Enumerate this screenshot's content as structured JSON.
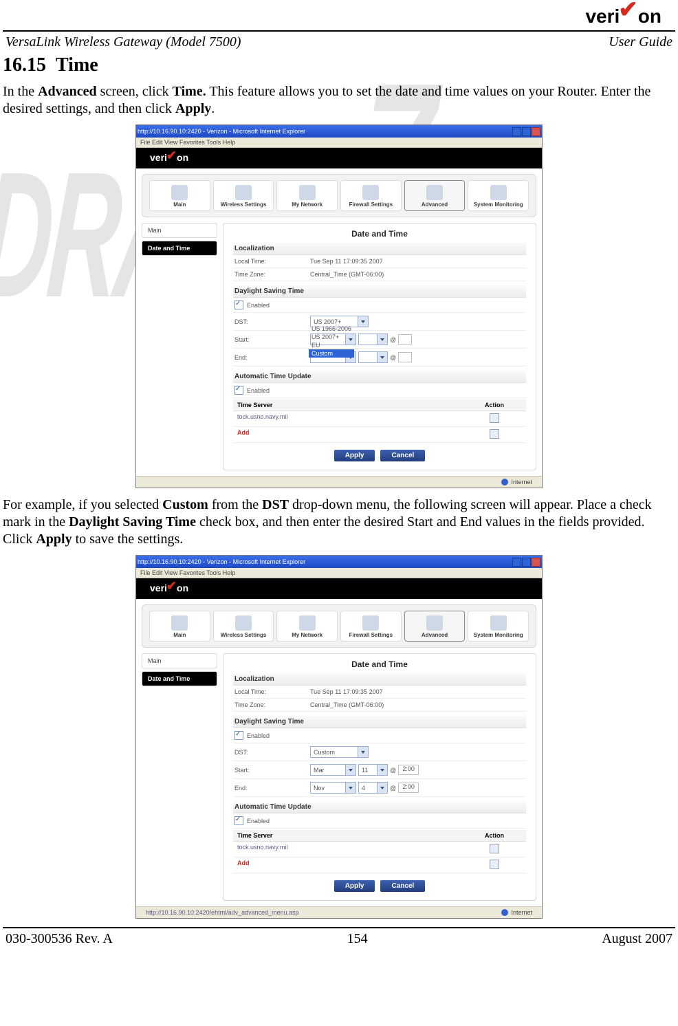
{
  "brand": {
    "name": "verizon"
  },
  "header": {
    "product": "VersaLink Wireless Gateway (Model 7500)",
    "doc_type": "User Guide"
  },
  "section": {
    "number": "16.15",
    "title": "Time"
  },
  "para1_parts": {
    "t1": "In the ",
    "b1": "Advanced",
    "t2": " screen, click ",
    "b2": "Time.",
    "t3": " This feature allows you to set the date and time values on your Router. Enter the desired settings, and then click ",
    "b3": "Apply",
    "t4": "."
  },
  "para2_parts": {
    "t1": "For example, if you selected ",
    "b1": "Custom",
    "t2": " from the ",
    "b2": "DST",
    "t3": " drop-down menu, the following screen will appear. Place a check mark in the ",
    "b3": "Daylight Saving Time",
    "t4": " check box, and then enter the desired Start and End values in the fields provided. Click ",
    "b4": "Apply",
    "t5": " to save the settings."
  },
  "watermark": "DRAFT",
  "browser": {
    "title_a": "http://10.16.90.10:2420 - Verizon - Microsoft Internet Explorer",
    "title_b": "http://10.16.90.10:2420 - Verizon - Microsoft Internet Explorer",
    "menu": "File   Edit   View   Favorites   Tools   Help",
    "status_url": "http://10.16.90.10:2420/ehtml/adv_advanced_menu.asp",
    "status_zone": "Internet"
  },
  "nav_tabs": {
    "main": "Main",
    "wireless": "Wireless\nSettings",
    "network": "My Network",
    "firewall": "Firewall\nSettings",
    "advanced": "Advanced",
    "sysmon": "System\nMonitoring"
  },
  "sidebar": {
    "head": "Main",
    "item": "Date and Time"
  },
  "panel": {
    "title": "Date and Time",
    "sect_localization": "Localization",
    "local_time_k": "Local Time:",
    "local_time_v": "Tue Sep 11 17:09:35 2007",
    "time_zone_k": "Time Zone:",
    "time_zone_v": "Central_Time (GMT-06:00)",
    "sect_dst": "Daylight Saving Time",
    "enabled": "Enabled",
    "dst_k": "DST:",
    "start_k": "Start:",
    "end_k": "End:",
    "sect_atu": "Automatic Time Update",
    "ts_head_server": "Time Server",
    "ts_head_action": "Action",
    "ts_server": "tock.usno.navy.mil",
    "ts_add": "Add",
    "btn_apply": "Apply",
    "btn_cancel": "Cancel"
  },
  "shot_a": {
    "dst_value": "US 2007+",
    "dst_opts": {
      "a": "US 1966-2006",
      "b": "US 2007+",
      "c": "EU",
      "d": "Custom"
    }
  },
  "shot_b": {
    "dst_value": "Custom",
    "start": {
      "mon": "Mar",
      "day": "11",
      "at": "@",
      "time": "2:00"
    },
    "end": {
      "mon": "Nov",
      "day": "4",
      "at": "@",
      "time": "2:00"
    }
  },
  "footer": {
    "left": "030-300536 Rev. A",
    "mid": "154",
    "right": "August 2007"
  }
}
